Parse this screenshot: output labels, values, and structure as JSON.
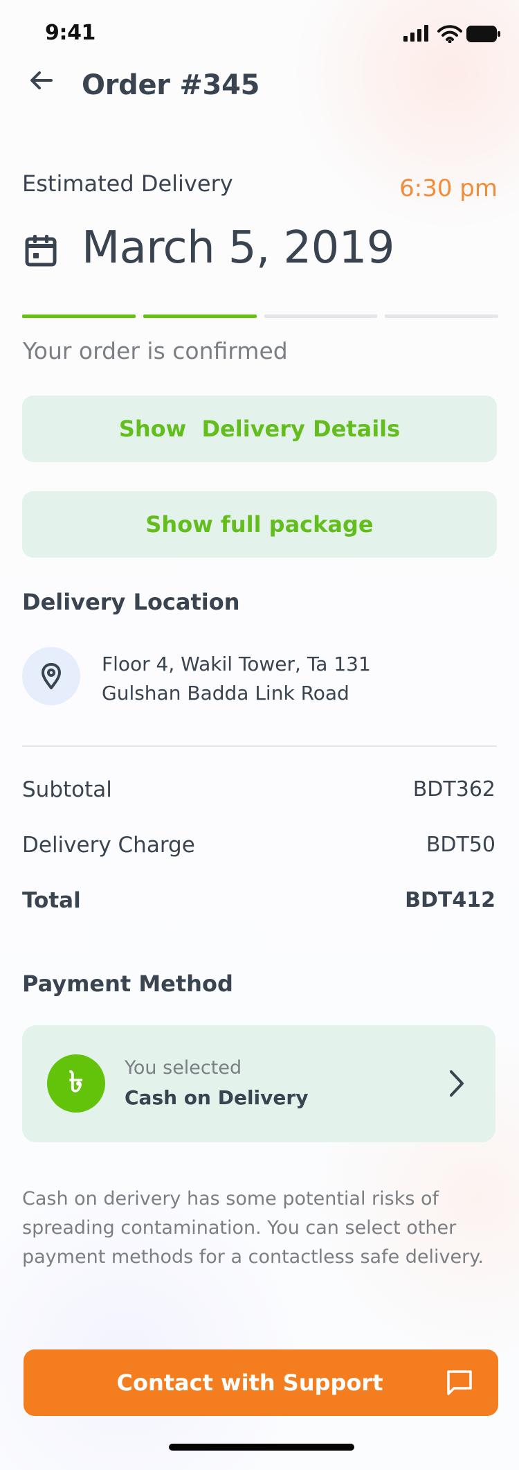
{
  "status_bar": {
    "time": "9:41",
    "icons": [
      "signal-icon",
      "wifi-icon",
      "battery-icon"
    ]
  },
  "header": {
    "title": "Order #345",
    "back_icon": "arrow-left-icon"
  },
  "estimated_delivery": {
    "label": "Estimated Delivery",
    "time": "6:30 pm",
    "date": "March 5, 2019",
    "calendar_icon": "calendar-icon"
  },
  "progress": {
    "total_steps": 4,
    "completed_steps": 2,
    "status": "Your order is confirmed"
  },
  "buttons": {
    "delivery_details": "Show  Delivery Details",
    "full_package": "Show full package"
  },
  "delivery_location": {
    "title": "Delivery Location",
    "address": "Floor 4, Wakil Tower, Ta 131 Gulshan Badda Link Road",
    "icon": "location-pin-icon"
  },
  "summary": {
    "subtotal_label": "Subtotal",
    "subtotal_value": "BDT362",
    "delivery_charge_label": "Delivery Charge",
    "delivery_charge_value": "BDT50",
    "total_label": "Total",
    "total_value": "BDT412"
  },
  "payment": {
    "title": "Payment Method",
    "caption": "You selected",
    "method": "Cash on Delivery",
    "currency_symbol": "৳",
    "icon": "taka-icon",
    "chevron_icon": "chevron-right-icon"
  },
  "warning": {
    "text": "Cash on derivery has some potential risks of spreading contamination. You can select other payment methods for a contactless safe delivery."
  },
  "support": {
    "label": "Contact with Support",
    "icon": "chat-icon"
  },
  "colors": {
    "accent_green": "#65c20d",
    "accent_orange": "#f47d20",
    "text_dark": "#3a4450",
    "text_muted": "#7b7f84",
    "soft_green": "#e3f3ec"
  }
}
